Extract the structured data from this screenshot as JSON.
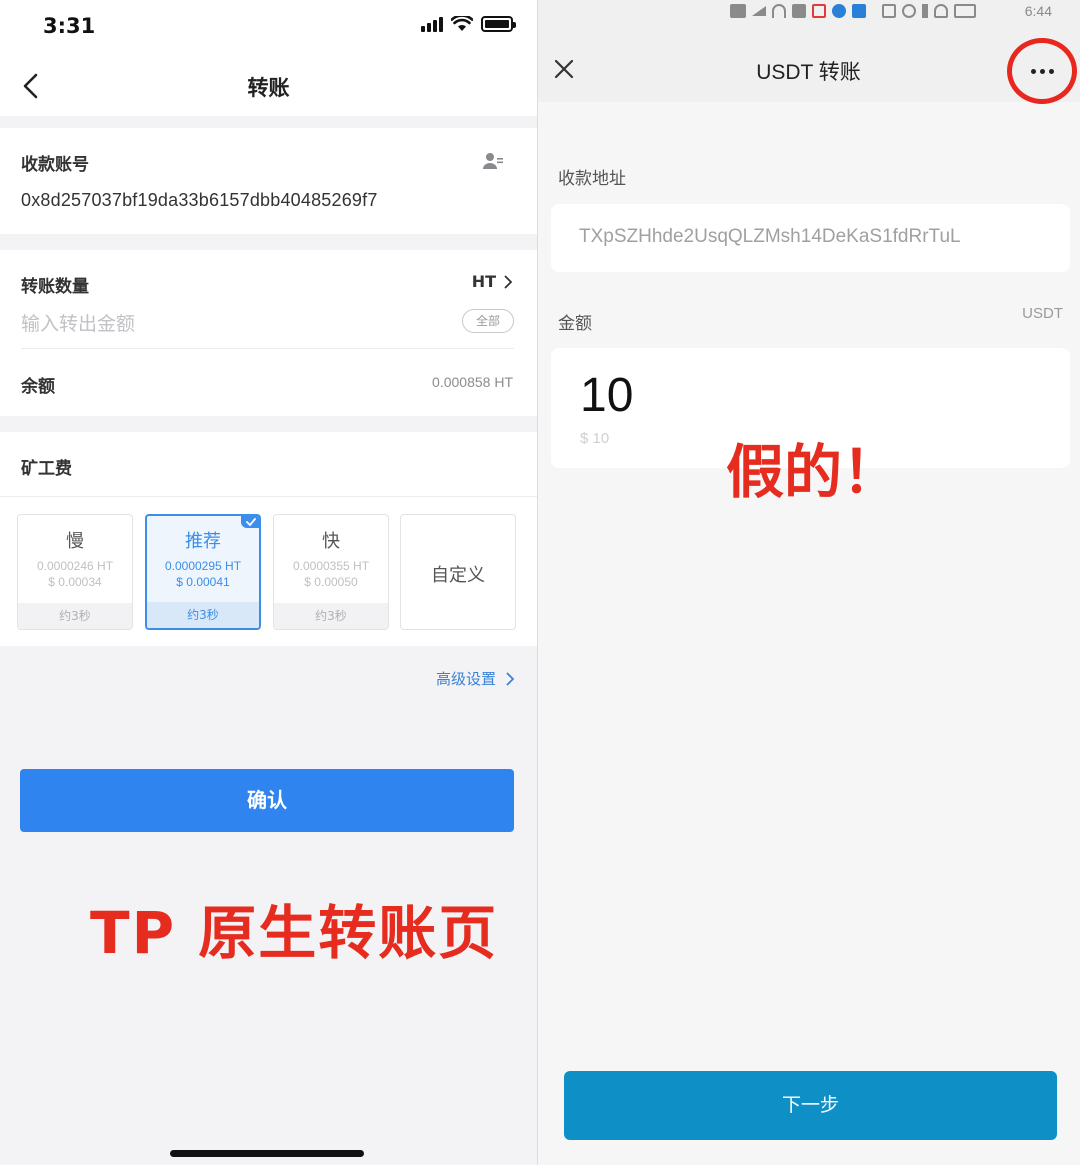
{
  "left": {
    "status_bar": {
      "time": "3:31"
    },
    "nav": {
      "title": "转账",
      "back_icon": "chevron-left-icon"
    },
    "account": {
      "label": "收款账号",
      "value": "0x8d257037bf19da33b6157dbb40485269f7",
      "contact_icon": "contact-book-icon"
    },
    "amount": {
      "label": "转账数量",
      "token": "HT",
      "placeholder": "输入转出金额",
      "all_button": "全部",
      "balance_label": "余额",
      "balance_value": "0.000858 HT"
    },
    "fee": {
      "label": "矿工费",
      "options": [
        {
          "name": "慢",
          "amount": "0.0000246 HT",
          "usd": "$ 0.00034",
          "time": "约3秒",
          "selected": false
        },
        {
          "name": "推荐",
          "amount": "0.0000295 HT",
          "usd": "$ 0.00041",
          "time": "约3秒",
          "selected": true
        },
        {
          "name": "快",
          "amount": "0.0000355 HT",
          "usd": "$ 0.00050",
          "time": "约3秒",
          "selected": false
        }
      ],
      "custom": "自定义"
    },
    "advanced": "高级设置",
    "confirm_button": "确认",
    "caption": "TP 原生转账页"
  },
  "right": {
    "status_bar": {
      "text": "6:44"
    },
    "header": {
      "title": "USDT 转账",
      "close_icon": "close-icon",
      "more_icon": "more-dots-icon"
    },
    "address": {
      "label": "收款地址",
      "value": "TXpSZHhde2UsqQLZMsh14DeKaS1fdRrTuL"
    },
    "amount": {
      "label": "金额",
      "unit": "USDT",
      "value": "10",
      "usd": "$ 10"
    },
    "caption": "假的！",
    "next_button": "下一步"
  },
  "colors": {
    "tp_blue": "#2f84ef",
    "selected_blue": "#3b8eea",
    "annotation_red": "#e52c1f",
    "next_button": "#0e90c7"
  }
}
